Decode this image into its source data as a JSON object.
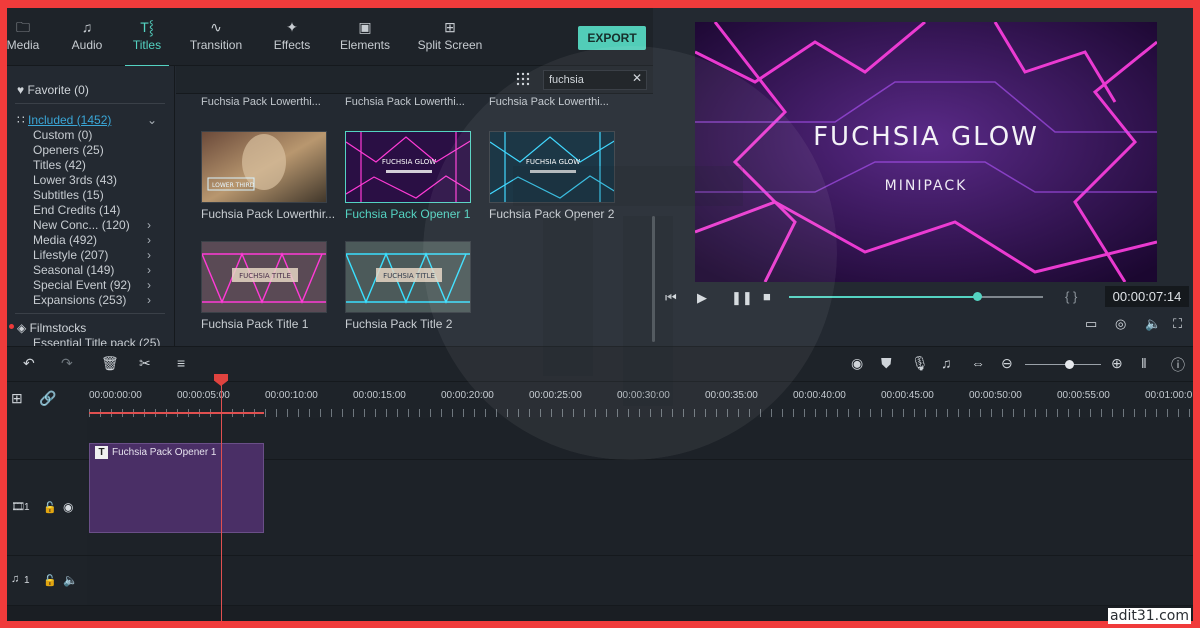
{
  "tabs": [
    {
      "label": "Media",
      "icon": "folder-icon",
      "active": false
    },
    {
      "label": "Audio",
      "icon": "music-note-icon",
      "active": false
    },
    {
      "label": "Titles",
      "icon": "titles-icon",
      "active": true
    },
    {
      "label": "Transition",
      "icon": "transition-icon",
      "active": false
    },
    {
      "label": "Effects",
      "icon": "effects-icon",
      "active": false
    },
    {
      "label": "Elements",
      "icon": "image-icon",
      "active": false
    },
    {
      "label": "Split Screen",
      "icon": "split-screen-icon",
      "active": false
    }
  ],
  "export_label": "EXPORT",
  "sidebar": {
    "favorite": "Favorite (0)",
    "included": "Included (1452)",
    "items": [
      {
        "label": "Custom (0)",
        "arrow": false
      },
      {
        "label": "Openers (25)",
        "arrow": false
      },
      {
        "label": "Titles (42)",
        "arrow": false
      },
      {
        "label": "Lower 3rds (43)",
        "arrow": false
      },
      {
        "label": "Subtitles (15)",
        "arrow": false
      },
      {
        "label": "End Credits (14)",
        "arrow": false
      },
      {
        "label": "New Conc... (120)",
        "arrow": true
      },
      {
        "label": "Media (492)",
        "arrow": true
      },
      {
        "label": "Lifestyle (207)",
        "arrow": true
      },
      {
        "label": "Seasonal (149)",
        "arrow": true
      },
      {
        "label": "Special Event (92)",
        "arrow": true
      },
      {
        "label": "Expansions (253)",
        "arrow": true
      }
    ],
    "filmstocks": "Filmstocks",
    "filmstocks_item": "Essential Title pack (25)"
  },
  "search": {
    "value": "fuchsia",
    "placeholder": "Search"
  },
  "library": {
    "top_row": [
      "Fuchsia Pack Lowerthi...",
      "Fuchsia Pack Lowerthi...",
      "Fuchsia Pack Lowerthi..."
    ],
    "items": [
      {
        "label": "Fuchsia Pack Lowerthir...",
        "caption": "LOWER THIRD",
        "selected": false
      },
      {
        "label": "Fuchsia Pack Opener 1",
        "caption": "FUCHSIA GLOW",
        "selected": true
      },
      {
        "label": "Fuchsia Pack Opener 2",
        "caption": "FUCHSIA GLOW",
        "selected": false
      },
      {
        "label": "Fuchsia Pack Title 1",
        "caption": "FUCHSIA TITLE",
        "selected": false
      },
      {
        "label": "Fuchsia Pack Title 2",
        "caption": "FUCHSIA TITLE",
        "selected": false
      }
    ]
  },
  "preview": {
    "title": "FUCHSIA GLOW",
    "subtitle": "MINIPACK",
    "timecode": "00:00:07:14",
    "progress": 0.74
  },
  "ruler": [
    "00:00:00:00",
    "00:00:05:00",
    "00:00:10:00",
    "00:00:15:00",
    "00:00:20:00",
    "00:00:25:00",
    "00:00:30:00",
    "00:00:35:00",
    "00:00:40:00",
    "00:00:45:00",
    "00:00:50:00",
    "00:00:55:00",
    "00:01:00:0"
  ],
  "timeline": {
    "clip_title": "Fuchsia Pack Opener 1",
    "video_track": "1",
    "audio_track": "1"
  },
  "watermark": "adit31.com",
  "colors": {
    "accent": "#54d3c2",
    "frame": "#f03b3b",
    "clip": "#4a2f66",
    "playhead": "#e0433f"
  }
}
